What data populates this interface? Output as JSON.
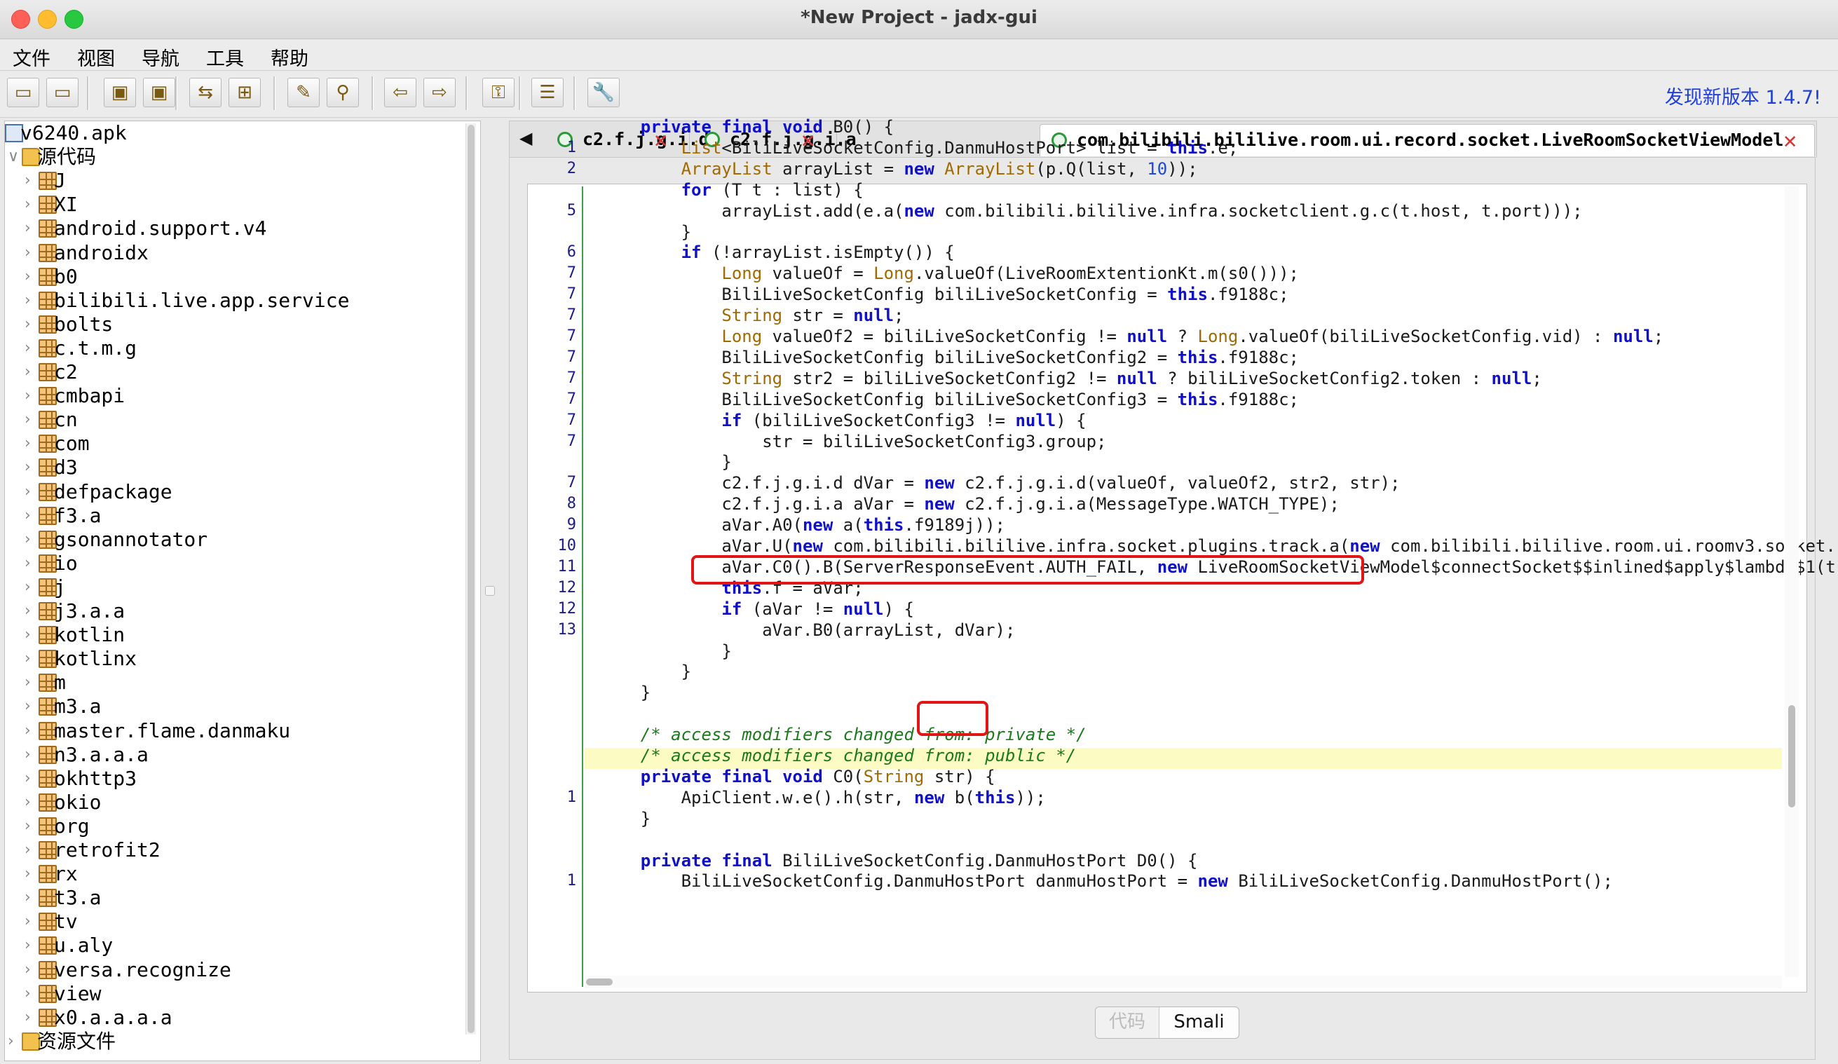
{
  "window": {
    "title": "*New Project - jadx-gui"
  },
  "menu": [
    "文件",
    "视图",
    "导航",
    "工具",
    "帮助"
  ],
  "toolbar": {
    "buttons": [
      {
        "name": "open-file-button",
        "icon": "open-folder-icon",
        "glyph": "▭"
      },
      {
        "name": "add-file-button",
        "icon": "add-folder-icon",
        "glyph": "▭"
      },
      {
        "name": "save-all-button",
        "icon": "save-all-icon",
        "glyph": "▣"
      },
      {
        "name": "export-button",
        "icon": "export-icon",
        "glyph": "▣"
      },
      {
        "name": "sync-tree-button",
        "icon": "sync-icon",
        "glyph": "⇆"
      },
      {
        "name": "flatten-packages-button",
        "icon": "packages-icon",
        "glyph": "⊞"
      },
      {
        "name": "search-text-button",
        "icon": "magic-wand-icon",
        "glyph": "✎"
      },
      {
        "name": "search-class-button",
        "icon": "magnifier-icon",
        "glyph": "⚲"
      },
      {
        "name": "back-button",
        "icon": "arrow-left-icon",
        "glyph": "⇦"
      },
      {
        "name": "forward-button",
        "icon": "arrow-right-icon",
        "glyph": "⇨"
      },
      {
        "name": "decompile-all-button",
        "icon": "package-lock-icon",
        "glyph": "⚿"
      },
      {
        "name": "log-viewer-button",
        "icon": "log-icon",
        "glyph": "☰"
      },
      {
        "name": "preferences-button",
        "icon": "wrench-icon",
        "glyph": "🔧"
      }
    ],
    "update_text": "发现新版本 1.4.7!"
  },
  "tree": {
    "root": "v6240.apk",
    "source_label": "源代码",
    "packages": [
      "J",
      "XI",
      "android.support.v4",
      "androidx",
      "b0",
      "bilibili.live.app.service",
      "bolts",
      "c.t.m.g",
      "c2",
      "cmbapi",
      "cn",
      "com",
      "d3",
      "defpackage",
      "f3.a",
      "gsonannotator",
      "io",
      "j",
      "j3.a.a",
      "kotlin",
      "kotlinx",
      "m",
      "m3.a",
      "master.flame.danmaku",
      "n3.a.a.a",
      "okhttp3",
      "okio",
      "org",
      "retrofit2",
      "rx",
      "t3.a",
      "tv",
      "u.aly",
      "versa.recognize",
      "view",
      "x0.a.a.a.a"
    ],
    "resources_label": "资源文件"
  },
  "tabs": [
    {
      "label": "c2.f.j.g.i.d",
      "active": false
    },
    {
      "label": "c2.f.j.g.i.a",
      "active": false
    },
    {
      "label": "com.bilibili.bililive.room.ui.record.socket.LiveRoomSocketViewModel",
      "active": true
    }
  ],
  "code": {
    "lines": [
      {
        "n": "",
        "t": "    <span class=\"kw\">private final void</span> B0() {"
      },
      {
        "n": "1",
        "t": "        <span class=\"ty\">List</span>&lt;BiliLiveSocketConfig.DanmuHostPort&gt; list = <span class=\"kw\">this</span>.e;"
      },
      {
        "n": "2",
        "t": "        <span class=\"ty\">ArrayList</span> arrayList = <span class=\"kw\">new</span> <span class=\"ty\">ArrayList</span>(p.Q(list, <span class=\"num\">10</span>));"
      },
      {
        "n": "",
        "t": "        <span class=\"kw\">for</span> (T t : list) {"
      },
      {
        "n": "5",
        "t": "            arrayList.add(e.a(<span class=\"kw\">new</span> com.bilibili.bililive.infra.socketclient.g.c(t.host, t.port)));"
      },
      {
        "n": "",
        "t": "        }"
      },
      {
        "n": "6",
        "t": "        <span class=\"kw\">if</span> (!arrayList.isEmpty()) {"
      },
      {
        "n": "7",
        "t": "            <span class=\"ty\">Long</span> valueOf = <span class=\"ty\">Long</span>.valueOf(LiveRoomExtentionKt.m(s0()));"
      },
      {
        "n": "7",
        "t": "            BiliLiveSocketConfig biliLiveSocketConfig = <span class=\"kw\">this</span>.f9188c;"
      },
      {
        "n": "7",
        "t": "            <span class=\"ty\">String</span> str = <span class=\"kw\">null</span>;"
      },
      {
        "n": "7",
        "t": "            <span class=\"ty\">Long</span> valueOf2 = biliLiveSocketConfig != <span class=\"kw\">null</span> ? <span class=\"ty\">Long</span>.valueOf(biliLiveSocketConfig.vid) : <span class=\"kw\">null</span>;"
      },
      {
        "n": "7",
        "t": "            BiliLiveSocketConfig biliLiveSocketConfig2 = <span class=\"kw\">this</span>.f9188c;"
      },
      {
        "n": "7",
        "t": "            <span class=\"ty\">String</span> str2 = biliLiveSocketConfig2 != <span class=\"kw\">null</span> ? biliLiveSocketConfig2.token : <span class=\"kw\">null</span>;"
      },
      {
        "n": "7",
        "t": "            BiliLiveSocketConfig biliLiveSocketConfig3 = <span class=\"kw\">this</span>.f9188c;"
      },
      {
        "n": "7",
        "t": "            <span class=\"kw\">if</span> (biliLiveSocketConfig3 != <span class=\"kw\">null</span>) {"
      },
      {
        "n": "7",
        "t": "                str = biliLiveSocketConfig3.group;"
      },
      {
        "n": "",
        "t": "            }"
      },
      {
        "n": "7",
        "t": "            c2.f.j.g.i.d dVar = <span class=\"kw\">new</span> c2.f.j.g.i.d(valueOf, valueOf2, str2, str);"
      },
      {
        "n": "8",
        "t": "            c2.f.j.g.i.a aVar = <span class=\"kw\">new</span> c2.f.j.g.i.a(MessageType.WATCH_TYPE);"
      },
      {
        "n": "9",
        "t": "            aVar.A0(<span class=\"kw\">new</span> a(<span class=\"kw\">this</span>.f9189j));"
      },
      {
        "n": "10",
        "t": "            aVar.U(<span class=\"kw\">new</span> com.bilibili.bililive.infra.socket.plugins.track.a(<span class=\"kw\">new</span> com.bilibili.bililive.room.ui.roomv3.socket."
      },
      {
        "n": "11",
        "t": "            aVar.C0().B(ServerResponseEvent.AUTH_FAIL, <span class=\"kw\">new</span> LiveRoomSocketViewModel$connectSocket$$inlined$apply$lambda$1(t"
      },
      {
        "n": "12",
        "t": "            <span class=\"kw\">this</span>.f = aVar;"
      },
      {
        "n": "12",
        "t": "            <span class=\"kw\">if</span> (aVar != <span class=\"kw\">null</span>) {"
      },
      {
        "n": "13",
        "t": "                aVar.B0(arrayList, dVar);"
      },
      {
        "n": "",
        "t": "            }"
      },
      {
        "n": "",
        "t": "        }"
      },
      {
        "n": "",
        "t": "    }"
      },
      {
        "n": "",
        "t": ""
      },
      {
        "n": "",
        "t": "    <span class=\"cm\">/* access modifiers changed from: private */</span>"
      },
      {
        "n": "",
        "t": "    <span class=\"cm\">/* access modifiers changed from: public */</span>"
      },
      {
        "n": "",
        "t": "    <span class=\"kw\">private final void</span> C0(<span class=\"ty\">String</span> str) {"
      },
      {
        "n": "1",
        "t": "        ApiClient.w.e().h(str, <span class=\"kw\">new</span> b(<span class=\"kw\">this</span>));"
      },
      {
        "n": "",
        "t": "    }"
      },
      {
        "n": "",
        "t": ""
      },
      {
        "n": "",
        "t": "    <span class=\"kw\">private final</span> BiliLiveSocketConfig.DanmuHostPort D0() {"
      },
      {
        "n": "1",
        "t": "        BiliLiveSocketConfig.DanmuHostPort danmuHostPort = <span class=\"kw\">new</span> BiliLiveSocketConfig.DanmuHostPort();"
      }
    ]
  },
  "bottom_toggle": {
    "code_label": "代码",
    "smali_label": "Smali"
  }
}
